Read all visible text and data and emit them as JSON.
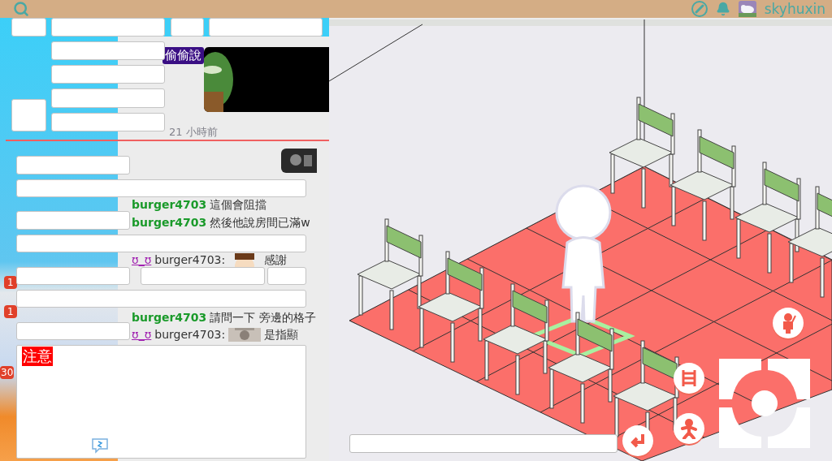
{
  "top_bar": {
    "username": "skyhuxin"
  },
  "sidebar": {
    "badges": [
      "1",
      "1",
      "30"
    ]
  },
  "chat": {
    "whisper_badge": "偷偷說",
    "timestamp": "21 小時前",
    "messages": [
      {
        "kind": "line",
        "user": "burger4703",
        "text": "這個會阻擋"
      },
      {
        "kind": "line",
        "user": "burger4703",
        "text": "然後他說房間已滿w"
      },
      {
        "kind": "reply",
        "emote": "ʊ_ʊ",
        "user": "burger4703:",
        "text": "感謝"
      },
      {
        "kind": "line",
        "user": "burger4703",
        "text": "請問一下 旁邊的格子"
      },
      {
        "kind": "reply",
        "emote": "ʊ_ʊ",
        "user": "burger4703:",
        "text": "是指顯"
      }
    ]
  },
  "notice": {
    "label": "注意"
  }
}
